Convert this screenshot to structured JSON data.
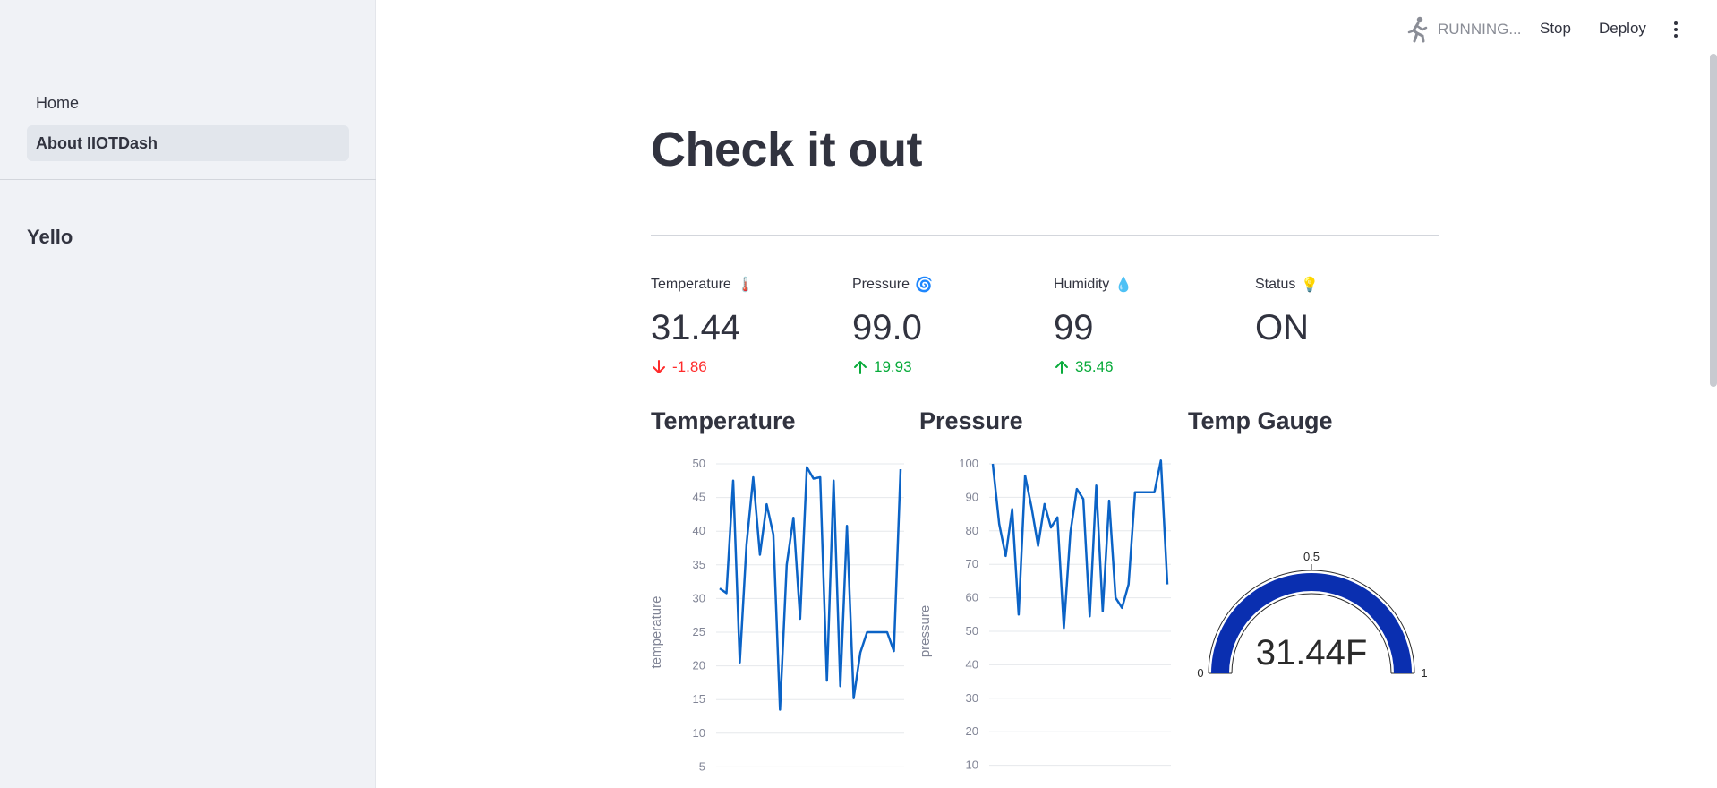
{
  "sidebar": {
    "items": [
      {
        "label": "Home",
        "active": false
      },
      {
        "label": "About IIOTDash",
        "active": true
      }
    ],
    "heading": "Yello"
  },
  "header": {
    "status": "RUNNING...",
    "stop_label": "Stop",
    "deploy_label": "Deploy",
    "menu_icon": "vertical-dots-icon",
    "running_icon": "running-man-icon"
  },
  "main": {
    "title": "Check it out",
    "metrics": [
      {
        "label": "Temperature",
        "icon": "🌡️",
        "value": "31.44",
        "delta": "-1.86",
        "direction": "down"
      },
      {
        "label": "Pressure",
        "icon": "🌀",
        "value": "99.0",
        "delta": "19.93",
        "direction": "up"
      },
      {
        "label": "Humidity",
        "icon": "💧",
        "value": "99",
        "delta": "35.46",
        "direction": "up"
      },
      {
        "label": "Status",
        "icon": "💡",
        "value": "ON",
        "delta": "",
        "direction": "none"
      }
    ],
    "sections": [
      "Temperature",
      "Pressure",
      "Temp Gauge"
    ]
  },
  "colors": {
    "line": "#0b63c6",
    "gauge_bar": "#0a2fb0",
    "delta_down": "#ff2b2b",
    "delta_up": "#09ab3b"
  },
  "chart_data": [
    {
      "type": "line",
      "ylabel": "temperature",
      "ylim": [
        0,
        50
      ],
      "yticks": [
        5,
        10,
        15,
        20,
        25,
        30,
        35,
        40,
        45,
        50
      ],
      "values": [
        31.5,
        30.8,
        47.5,
        20.5,
        38,
        48,
        36.5,
        44,
        39.5,
        13.5,
        35,
        42,
        27,
        49.5,
        47.8,
        48,
        17.8,
        47.5,
        17,
        40.8,
        15.2,
        22,
        25,
        25,
        25,
        25,
        22.2,
        49.2
      ],
      "grid": true
    },
    {
      "type": "line",
      "ylabel": "pressure",
      "ylim": [
        0,
        100
      ],
      "yticks": [
        10,
        20,
        30,
        40,
        50,
        60,
        70,
        80,
        90,
        100
      ],
      "values": [
        100,
        82,
        72.5,
        86.5,
        55,
        96.5,
        87,
        75.5,
        88,
        81,
        84,
        51,
        79.5,
        92.5,
        89.5,
        54.5,
        93.5,
        56,
        89,
        60,
        57,
        64,
        91.5,
        91.5,
        91.5,
        91.5,
        101,
        64
      ],
      "grid": true
    },
    {
      "type": "gauge",
      "value": 31.44,
      "display": "31.44F",
      "range": [
        0,
        1
      ],
      "ticks": [
        "0",
        "0.5",
        "1"
      ]
    }
  ]
}
